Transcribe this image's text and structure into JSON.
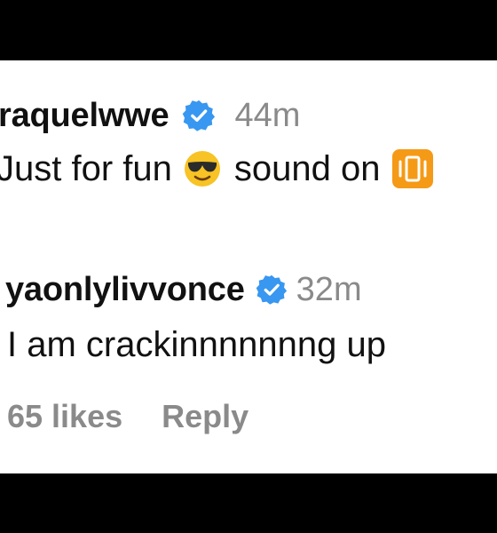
{
  "comments": [
    {
      "username": "raquelwwe",
      "verified": true,
      "time": "44m",
      "text_before": "Just for fun",
      "text_after": "sound on",
      "emojis": [
        "smiling-face-with-sunglasses",
        "vibration-mode"
      ]
    },
    {
      "username": "yaonlylivvonce",
      "verified": true,
      "time": "32m",
      "text": "I am crackinnnnnnng up",
      "likes": "65 likes",
      "reply_label": "Reply"
    }
  ],
  "colors": {
    "verified_blue": "#3897f0",
    "username": "#111111",
    "meta_gray": "#8a8a8a",
    "emoji_yellow": "#f7c325",
    "sound_orange": "#f59a16"
  }
}
